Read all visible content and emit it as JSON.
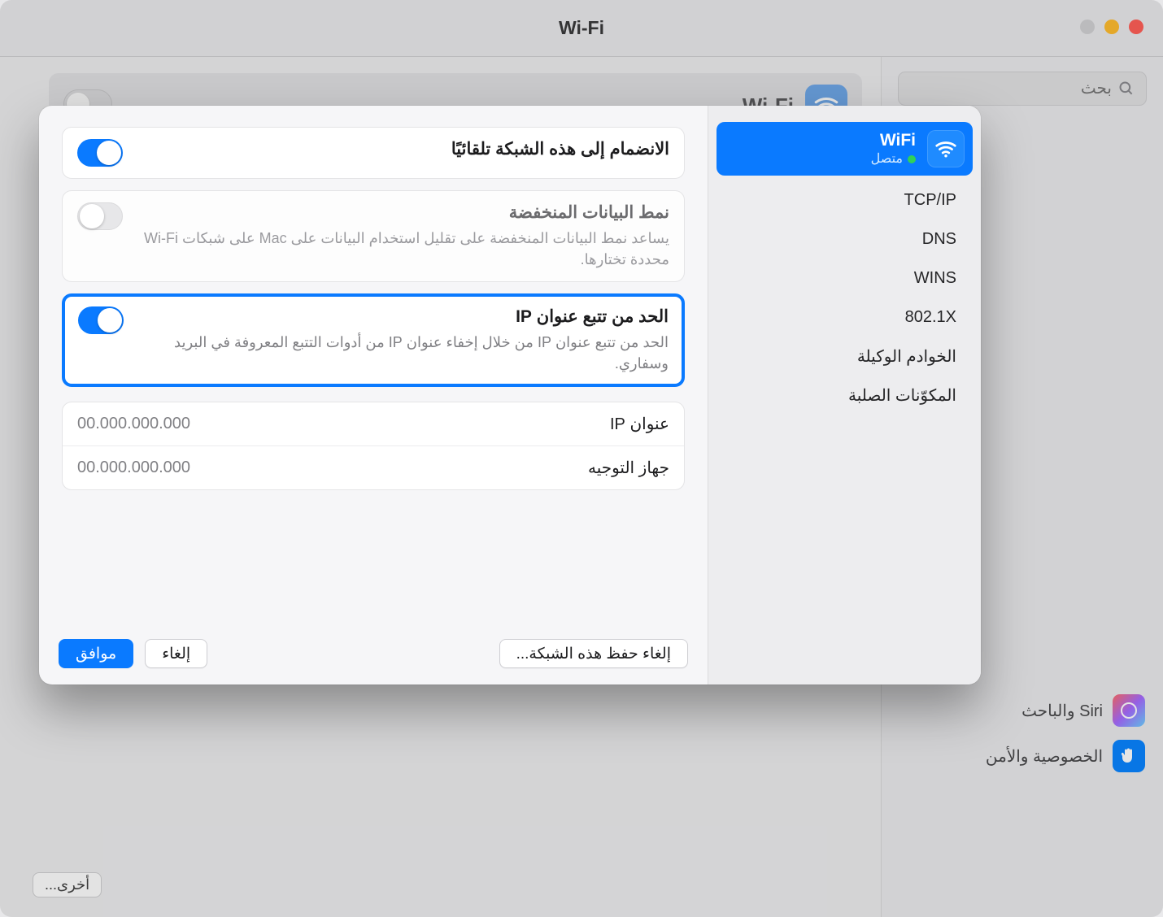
{
  "window": {
    "title": "Wi-Fi",
    "search_placeholder": "بحث",
    "wifi_card_label": "Wi-Fi",
    "other_button": "أخرى...",
    "bg_sidebar": {
      "siri": "Siri والباحث",
      "privacy": "الخصوصية والأمن"
    }
  },
  "modal": {
    "sidebar": {
      "selected": {
        "title": "WiFi",
        "subtitle": "متصل"
      },
      "items": [
        "TCP/IP",
        "DNS",
        "WINS",
        "802.1X",
        "الخوادم الوكيلة",
        "المكوّنات الصلبة"
      ]
    },
    "settings": {
      "auto_join": {
        "title": "الانضمام إلى هذه الشبكة تلقائيًا",
        "on": true
      },
      "low_data": {
        "title": "نمط البيانات المنخفضة",
        "desc": "يساعد نمط البيانات المنخفضة على تقليل استخدام البيانات على Mac على شبكات Wi-Fi محددة تختارها.",
        "on": false
      },
      "limit_ip": {
        "title": "الحد من تتبع عنوان IP",
        "desc": "الحد من تتبع عنوان IP من خلال إخفاء عنوان IP من أدوات التتبع المعروفة في البريد وسفاري.",
        "on": true
      },
      "ip": {
        "label": "عنوان IP",
        "value": "00.000.000.000"
      },
      "router": {
        "label": "جهاز التوجيه",
        "value": "00.000.000.000"
      }
    },
    "footer": {
      "forget": "إلغاء حفظ هذه الشبكة...",
      "cancel": "إلغاء",
      "ok": "موافق"
    }
  }
}
